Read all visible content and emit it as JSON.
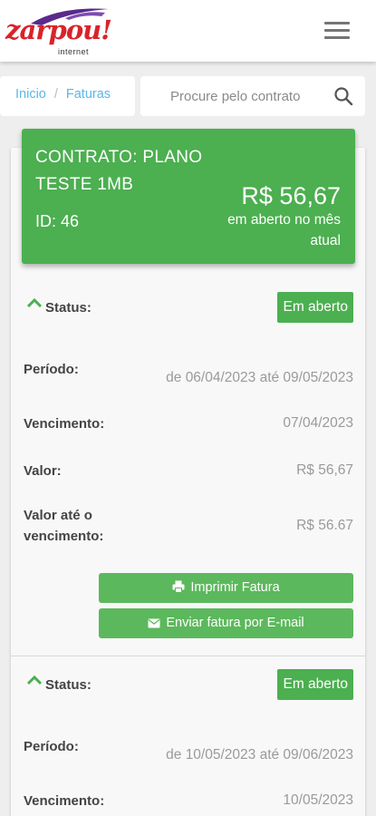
{
  "header": {
    "logo_text": "zarpou!",
    "logo_sub": "internet",
    "menu_icon": "hamburger-menu-icon"
  },
  "breadcrumb": {
    "home": "Inicio",
    "separator": "/",
    "current": "Faturas"
  },
  "search": {
    "placeholder": "Procure pelo contrato",
    "icon": "search-icon"
  },
  "contract": {
    "name": "CONTRATO: PLANO TESTE 1MB",
    "id_text": "ID: 46",
    "amount": "R$ 56,67",
    "amount_label": "em aberto no mês atual"
  },
  "invoices": [
    {
      "status_label": "Status:",
      "status_value": "Em aberto",
      "period_label": "Período:",
      "period_value": "de 06/04/2023 até 09/05/2023",
      "due_label": "Vencimento:",
      "due_value": "07/04/2023",
      "value_label": "Valor:",
      "value_value": "R$ 56,67",
      "value_due_label": "Valor até o vencimento:",
      "value_due_value": "R$ 56.67",
      "print_label": "Imprimir Fatura",
      "email_label": "Enviar fatura por E-mail"
    },
    {
      "status_label": "Status:",
      "status_value": "Em aberto",
      "period_label": "Período:",
      "period_value": "de 10/05/2023 até 09/06/2023",
      "due_label": "Vencimento:",
      "due_value": "10/05/2023"
    }
  ],
  "colors": {
    "brand_red": "#d8232a",
    "brand_purple": "#5a2a8c",
    "accent_green": "#4caf50",
    "link_blue": "#5ab7e8"
  }
}
